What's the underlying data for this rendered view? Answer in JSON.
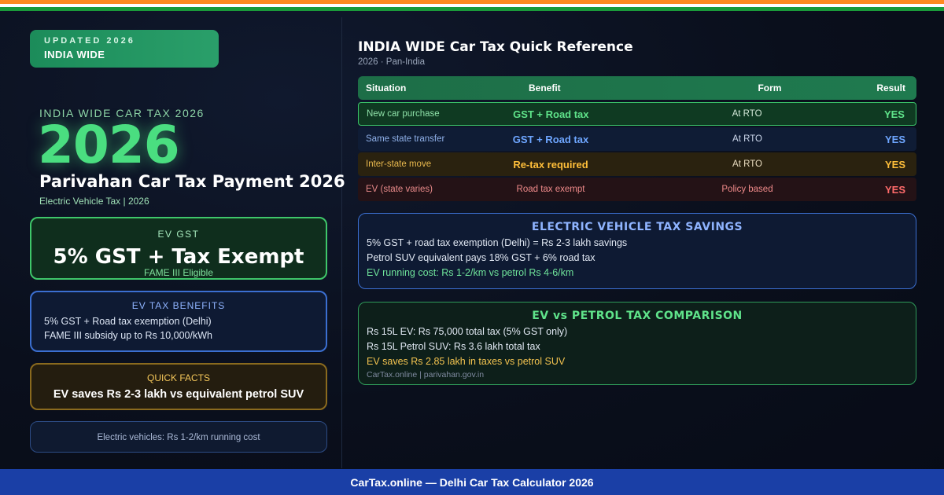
{
  "badge": {
    "line1": "UPDATED 2026",
    "line2": "INDIA WIDE"
  },
  "hero": {
    "eyebrow": "INDIA WIDE CAR TAX 2026",
    "year": "2026",
    "title": "Parivahan Car Tax Payment 2026",
    "subtitle": "Electric Vehicle Tax | 2026"
  },
  "gst_card": {
    "label": "EV GST",
    "value": "5% GST + Tax Exempt",
    "sub": "FAME III Eligible"
  },
  "benefits_card": {
    "title": "EV TAX BENEFITS",
    "items": [
      "5% GST + Road tax exemption (Delhi)",
      "FAME III subsidy up to Rs 10,000/kWh"
    ]
  },
  "facts_card": {
    "title": "QUICK FACTS",
    "value": "EV saves Rs 2-3 lakh vs equivalent petrol SUV"
  },
  "note_card": {
    "text": "Electric vehicles: Rs 1-2/km running cost"
  },
  "reference": {
    "title": "INDIA WIDE Car Tax Quick Reference",
    "subtitle": "2026 · Pan-India",
    "headers": [
      "Situation",
      "Benefit",
      "Form",
      "Result"
    ],
    "rows": [
      {
        "situation": "New car purchase",
        "benefit": "GST + Road tax",
        "form": "At RTO",
        "result": "YES"
      },
      {
        "situation": "Same state transfer",
        "benefit": "GST + Road tax",
        "form": "At RTO",
        "result": "YES"
      },
      {
        "situation": "Inter-state move",
        "benefit": "Re-tax required",
        "form": "At RTO",
        "result": "YES"
      },
      {
        "situation": "EV (state varies)",
        "benefit": "Road tax exempt",
        "form": "Policy based",
        "result": "YES"
      }
    ]
  },
  "ev_savings": {
    "title": "ELECTRIC VEHICLE TAX SAVINGS",
    "lines": [
      "5% GST + road tax exemption (Delhi) = Rs 2-3 lakh savings",
      "Petrol SUV equivalent pays 18% GST + 6% road tax",
      "EV running cost: Rs 1-2/km vs petrol Rs 4-6/km"
    ]
  },
  "comparison": {
    "title": "EV vs PETROL TAX COMPARISON",
    "lines": [
      "Rs 15L EV: Rs 75,000 total tax (5% GST only)",
      "Rs 15L Petrol SUV: Rs 3.6 lakh total tax",
      "EV saves Rs 2.85 lakh in taxes vs petrol SUV"
    ],
    "source": "CarTax.online | parivahan.gov.in"
  },
  "footer": {
    "text": "CarTax.online — Delhi Car Tax Calculator 2026"
  },
  "colors": {
    "accent_green": "#4ade80",
    "accent_blue": "#6ea6ff",
    "accent_amber": "#ffbf3a",
    "accent_red": "#ff6b6b",
    "footer_blue": "#1a3fa6",
    "flag_saffron": "#ff8a1f",
    "flag_green": "#1a9a3a"
  }
}
